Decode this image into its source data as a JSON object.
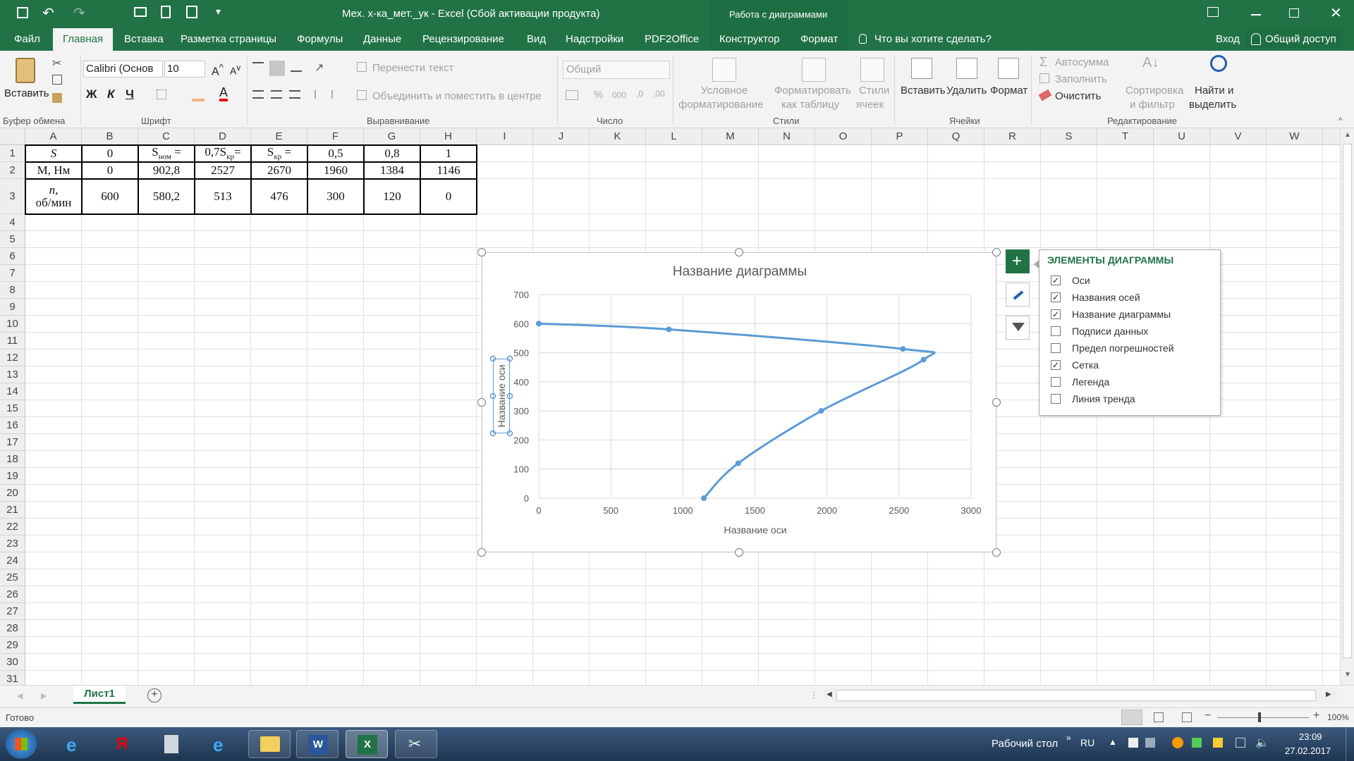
{
  "titlebar": {
    "title": "Мех. х-ка_мет._ук - Excel (Сбой активации продукта)",
    "context_group": "Работа с диаграммами"
  },
  "tabs": [
    "Файл",
    "Главная",
    "Вставка",
    "Разметка страницы",
    "Формулы",
    "Данные",
    "Рецензирование",
    "Вид",
    "Надстройки",
    "PDF2Office",
    "Конструктор",
    "Формат"
  ],
  "tell_me": "Что вы хотите сделать?",
  "signin": "Вход",
  "share": "Общий доступ",
  "ribbon": {
    "paste": "Вставить",
    "font_name": "Calibri (Основ",
    "font_size": "10",
    "bold": "Ж",
    "italic": "К",
    "underline": "Ч",
    "wrap_text": "Перенести текст",
    "merge_center": "Объединить и поместить в центре",
    "number_format": "Общий",
    "conditional": [
      "Условное",
      "форматирование"
    ],
    "format_table": [
      "Форматировать",
      "как таблицу"
    ],
    "cell_styles": [
      "Стили",
      "ячеек"
    ],
    "insert": "Вставить",
    "delete": "Удалить",
    "format": "Формат",
    "autosum": "Автосумма",
    "fill": "Заполнить",
    "clear": "Очистить",
    "sort": [
      "Сортировка",
      "и фильтр"
    ],
    "find": [
      "Найти и",
      "выделить"
    ],
    "groups": {
      "clipboard": "Буфер обмена",
      "font": "Шрифт",
      "alignment": "Выравнивание",
      "number": "Число",
      "styles": "Стили",
      "cells": "Ячейки",
      "editing": "Редактирование"
    }
  },
  "columns": [
    "A",
    "B",
    "C",
    "D",
    "E",
    "F",
    "G",
    "H",
    "I",
    "J",
    "K",
    "L",
    "M",
    "N",
    "O",
    "P",
    "Q",
    "R",
    "S",
    "T",
    "U",
    "V",
    "W"
  ],
  "rows": [
    "1",
    "2",
    "3",
    "4",
    "5",
    "6",
    "7",
    "8",
    "9",
    "10",
    "11",
    "12",
    "13",
    "14",
    "15",
    "16",
    "17",
    "18",
    "19",
    "20",
    "21",
    "22",
    "23",
    "24",
    "25",
    "26",
    "27",
    "28",
    "29",
    "30",
    "31"
  ],
  "table": {
    "row1": [
      {
        "main": "S",
        "sub": ""
      },
      {
        "main": "0",
        "sub": ""
      },
      {
        "main": "S",
        "sub": "ном",
        "suffix": " ="
      },
      {
        "main": "0,7S",
        "sub": "кр",
        "suffix": "="
      },
      {
        "main": "S",
        "sub": "кр",
        "suffix": " ="
      },
      {
        "main": "0,5",
        "sub": ""
      },
      {
        "main": "0,8",
        "sub": ""
      },
      {
        "main": "1",
        "sub": ""
      }
    ],
    "row2": [
      "M, Нм",
      "0",
      "902,8",
      "2527",
      "2670",
      "1960",
      "1384",
      "1146"
    ],
    "row3_label": [
      "n,",
      "об/мин"
    ],
    "row3": [
      "600",
      "580,2",
      "513",
      "476",
      "300",
      "120",
      "0"
    ]
  },
  "chart_data": {
    "type": "scatter",
    "title": "Название диаграммы",
    "xlabel": "Название оси",
    "ylabel": "Название оси",
    "xlim": [
      0,
      3000
    ],
    "ylim": [
      0,
      700
    ],
    "xticks": [
      "0",
      "500",
      "1000",
      "1500",
      "2000",
      "2500",
      "3000"
    ],
    "yticks": [
      "0",
      "100",
      "200",
      "300",
      "400",
      "500",
      "600",
      "700"
    ],
    "grid": true,
    "smooth": true,
    "series": [
      {
        "x": [
          0,
          902.8,
          2527,
          2670,
          1960,
          1384,
          1146
        ],
        "y": [
          600,
          580.2,
          513,
          476,
          300,
          120,
          0
        ]
      }
    ],
    "color": "#5b9bd5"
  },
  "chart_elements_panel": {
    "title": "ЭЛЕМЕНТЫ ДИАГРАММЫ",
    "items": [
      {
        "label": "Оси",
        "checked": true
      },
      {
        "label": "Названия осей",
        "checked": true
      },
      {
        "label": "Название диаграммы",
        "checked": true
      },
      {
        "label": "Подписи данных",
        "checked": false
      },
      {
        "label": "Предел погрешностей",
        "checked": false
      },
      {
        "label": "Сетка",
        "checked": true
      },
      {
        "label": "Легенда",
        "checked": false
      },
      {
        "label": "Линия тренда",
        "checked": false
      }
    ]
  },
  "sheet_tab": "Лист1",
  "status": "Готово",
  "zoom": "100%",
  "taskbar": {
    "desktop": "Рабочий стол",
    "lang": "RU",
    "time": "23:09",
    "date": "27.02.2017"
  }
}
